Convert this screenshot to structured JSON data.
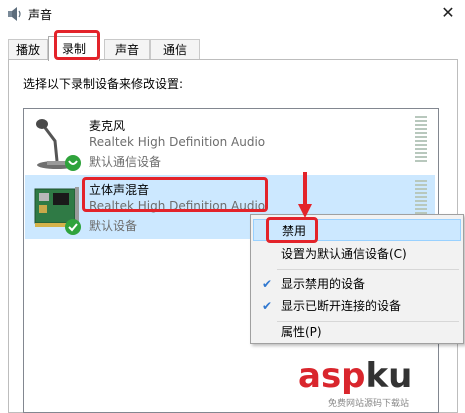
{
  "window": {
    "title": "声音"
  },
  "tabs": [
    {
      "label": "播放"
    },
    {
      "label": "录制"
    },
    {
      "label": "声音"
    },
    {
      "label": "通信"
    }
  ],
  "instruction": "选择以下录制设备来修改设置:",
  "devices": [
    {
      "name": "麦克风",
      "description": "Realtek High Definition Audio",
      "status": "默认通信设备",
      "icon": "microphone-icon"
    },
    {
      "name": "立体声混音",
      "description": "Realtek High Definition Audio",
      "status": "默认设备",
      "icon": "sound-card-icon"
    }
  ],
  "context_menu": {
    "items": [
      {
        "label": "禁用"
      },
      {
        "label": "设置为默认通信设备(C)"
      },
      {
        "label": "显示禁用的设备",
        "checked": true
      },
      {
        "label": "显示已断开连接的设备",
        "checked": true
      },
      {
        "label": "属性(P)"
      }
    ]
  },
  "watermark": {
    "brand_a": "asp",
    "brand_b": "ku",
    "tagline": "免费网站源码下载站"
  },
  "colors": {
    "selection": "#cce8ff",
    "annotation": "#e3232a",
    "check": "#3078d0"
  }
}
